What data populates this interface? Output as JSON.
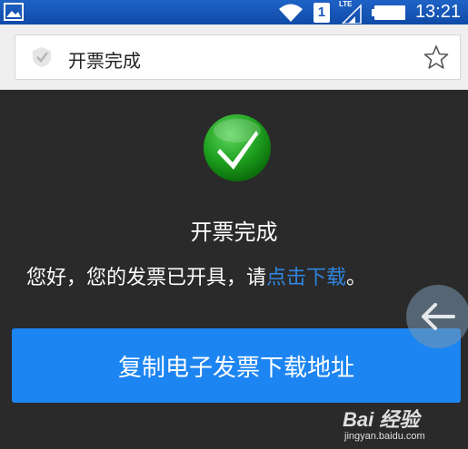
{
  "status_bar": {
    "sim_slot": "1",
    "network": "LTE",
    "time": "13:21",
    "icons": [
      "gallery-icon",
      "wifi-icon",
      "sim-icon",
      "signal-icon",
      "battery-icon"
    ]
  },
  "address_bar": {
    "title": "开票完成",
    "icons": [
      "shield-icon",
      "star-icon"
    ]
  },
  "page": {
    "heading": "开票完成",
    "message_prefix": "您好，您的发票已开具，请",
    "message_link": "点击下载",
    "message_suffix": "。",
    "copy_button_label": "复制电子发票下载地址"
  },
  "watermark": {
    "logo": "Bai 经验",
    "url": "jingyan.baidu.com"
  },
  "colors": {
    "status_bar": "#1a57b8",
    "background": "#2a2a2a",
    "link": "#2f86e0",
    "button": "#1d85f2",
    "check_green": "#1fa01f"
  }
}
